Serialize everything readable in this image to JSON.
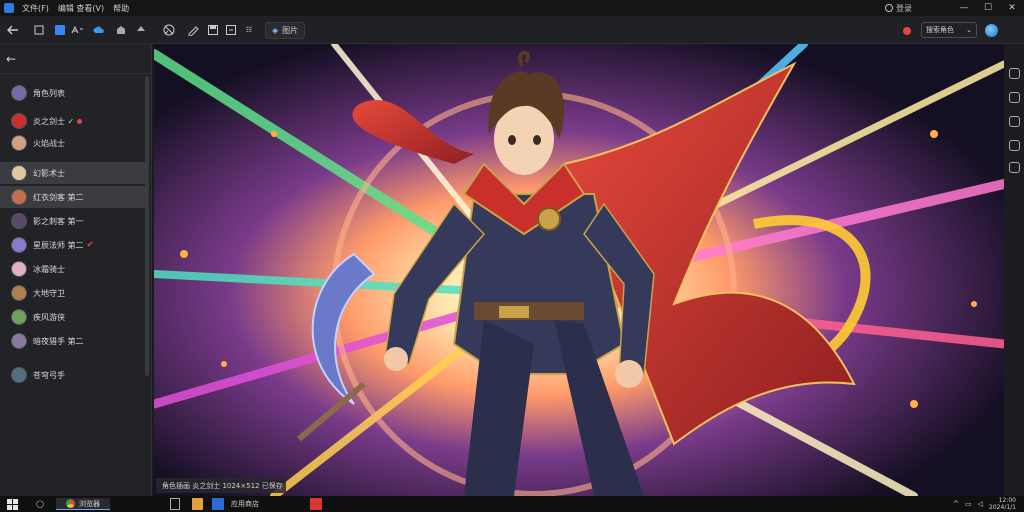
{
  "titlebar": {
    "menu": [
      "文件(F)",
      "编辑 查看(V)",
      "帮助"
    ],
    "account": "登录",
    "window_buttons": [
      "—",
      "☐",
      "✕"
    ]
  },
  "toolbar": {
    "tab_label": "图片",
    "search_value": "搜索角色",
    "dropdown_arrow": "⌄"
  },
  "sidebar": {
    "back_icon": "back-arrow-icon",
    "items": [
      {
        "label": "角色列表",
        "badge": ""
      },
      {
        "label": "炎之剑士 ✓",
        "badge": "dot"
      },
      {
        "label": "火焰战士",
        "badge": ""
      },
      {
        "label": "幻影术士",
        "badge": ""
      },
      {
        "label": "红衣剑客 第二",
        "badge": ""
      },
      {
        "label": "影之刺客 第一",
        "badge": ""
      },
      {
        "label": "星辰法师 第二",
        "badge": "check"
      },
      {
        "label": "冰霜骑士",
        "badge": ""
      },
      {
        "label": "大地守卫",
        "badge": ""
      },
      {
        "label": "疾风游侠",
        "badge": ""
      },
      {
        "label": "暗夜猎手 第二",
        "badge": ""
      },
      {
        "label": "苍穹弓手",
        "badge": ""
      }
    ]
  },
  "canvas": {
    "caption": "角色插画 炎之剑士 1024×512 已保存"
  },
  "taskbar": {
    "browser_label": "浏览器",
    "store_label": "应用商店",
    "time": "12:00",
    "date": "2024/1/1"
  },
  "colors": {
    "accent": "#2d7be0",
    "record": "#e8453c",
    "cape": "#c9302c",
    "gold": "#c9a24a"
  }
}
